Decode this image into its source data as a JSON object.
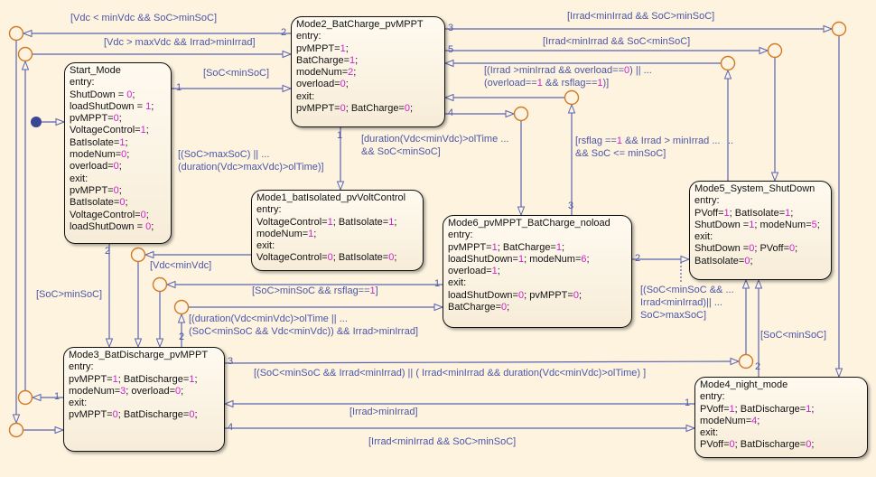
{
  "colors": {
    "background": "#fdf3df",
    "transition": "#5a64b0",
    "junction": "#d07a28",
    "number": "#d21fd0",
    "state_border": "#111111",
    "default_dot": "#3b4596"
  },
  "states": {
    "start": {
      "lines": [
        "Start_Mode",
        "entry:",
        "ShutDown = 0;",
        "loadShutDown = 1;",
        "pvMPPT=0;",
        "VoltageControl=1;",
        "BatIsolate=1;",
        "modeNum=0;",
        "overload=0;",
        "exit:",
        "pvMPPT=0;",
        "BatIsolate=0;",
        "VoltageControl=0;",
        "loadShutDown = 0;"
      ]
    },
    "mode2": {
      "lines": [
        "Mode2_BatCharge_pvMPPT",
        "entry:",
        "pvMPPT=1;",
        "BatCharge=1;",
        "modeNum=2;",
        "overload=0;",
        "exit:",
        "pvMPPT=0; BatCharge=0;"
      ]
    },
    "mode1": {
      "lines": [
        "Mode1_batIsolated_pvVoltControl",
        "entry:",
        "VoltageControl=1; BatIsolate=1;",
        "modeNum=1;",
        "exit:",
        "VoltageControl=0; BatIsolate=0;"
      ]
    },
    "mode6": {
      "lines": [
        "Mode6_pvMPPT_BatCharge_noload",
        "entry:",
        "pvMPPT=1; BatCharge=1;",
        "loadShutDown=1; modeNum=6;",
        "overload=1;",
        "exit:",
        "loadShutDown=0; pvMPPT=0;",
        "BatCharge=0;"
      ]
    },
    "mode5": {
      "lines": [
        "Mode5_System_ShutDown",
        "entry:",
        "PVoff=1; BatIsolate=1;",
        "ShutDown =1; modeNum=5;",
        "exit:",
        "ShutDown =0; PVoff=0;",
        "BatIsolate=0;"
      ]
    },
    "mode3": {
      "lines": [
        "Mode3_BatDischarge_pvMPPT",
        "entry:",
        "pvMPPT=1; BatDischarge=1;",
        "modeNum=3; overload=0;",
        "exit:",
        "pvMPPT=0;  BatDischarge=0;"
      ]
    },
    "mode4": {
      "lines": [
        "Mode4_night_mode",
        "entry:",
        "PVoff=1; BatDischarge=1;",
        "modeNum=4;",
        "exit:",
        "PVoff=0; BatDischarge=0;"
      ]
    }
  },
  "transition_labels": [
    "[Vdc < minVdc && SoC>minSoC]",
    "[Vdc > maxVdc && Irrad>minIrrad]",
    "[SoC<minSoC]",
    "[(SoC>maxSoC) || ...",
    "(duration(Vdc>maxVdc)>olTime)]",
    "[duration(Vdc<minVdc)>olTime ...",
    " && SoC<minSoC]",
    "[Irrad<minIrrad && SoC>minSoC]",
    "[Irrad<minIrrad && SoC<minSoC]",
    "[(Irrad >minIrrad && overload==0) || ...",
    "(overload==1 && rsflag==1)]",
    "[rsflag ==1 && Irrad > minIrrad  ...",
    "&& SoC <= minSoC]",
    "..",
    "[Vdc<minVdc]",
    "[SoC>minSoC]",
    "[SoC>minSoC && rsflag==1]",
    "[(duration(Vdc<minVdc)>olTime || ...",
    " (SoC<minSoC && Vdc<minVdc)) && Irrad>minIrrad]",
    "[(SoC<minSoC && ...",
    "Irrad<minIrrad)|| ...",
    "SoC>maxSoC]",
    "[SoC<minSoC]",
    "[(SoC<minSoC && Irrad<minIrrad) || ( Irrad<minIrrad && duration(Vdc<minVdc)>olTime) ]",
    "[Irrad>minIrrad]",
    "[Irrad<minIrrad && SoC>minSoC]"
  ],
  "execution_orders": [
    "2",
    "1",
    "1",
    "3",
    "5",
    "4",
    "3",
    "2",
    "2",
    "1",
    "2",
    "1",
    "3",
    "2",
    "1",
    "4"
  ]
}
